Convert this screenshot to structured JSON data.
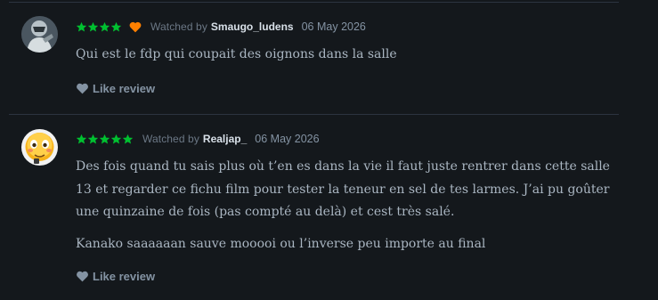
{
  "colors": {
    "background": "#14181c",
    "star": "#00c030",
    "liked_heart": "#ff8000",
    "text": "#aab6c2",
    "muted": "#6b7785"
  },
  "reviews": [
    {
      "avatar_icon": "user-avatar-icon",
      "rating_stars": 4,
      "liked": true,
      "watched_label": "Watched by",
      "username": "Smaugo_ludens",
      "date": "06 May 2026",
      "paragraphs": [
        "Qui est le fdp qui coupait des oignons dans la salle"
      ],
      "like_label": "Like review"
    },
    {
      "avatar_icon": "emoji-avatar-icon",
      "rating_stars": 5,
      "liked": false,
      "watched_label": "Watched by",
      "username": "Realjap_",
      "date": "06 May 2026",
      "paragraphs": [
        "Des fois quand tu sais plus où t’en es dans la vie il faut juste rentrer dans cette salle 13 et regarder ce fichu film pour tester la teneur en sel de tes larmes. J’ai pu goûter une quinzaine de fois (pas compté au delà) et cest très salé.",
        "Kanako saaaaaan sauve mooooi ou l’inverse peu importe au final"
      ],
      "like_label": "Like review"
    }
  ]
}
